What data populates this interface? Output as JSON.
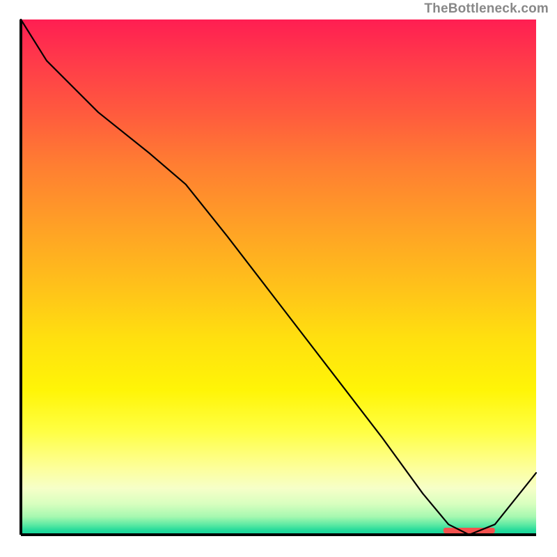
{
  "attribution": "TheBottleneck.com",
  "chart_data": {
    "type": "line",
    "title": "",
    "xlabel": "",
    "ylabel": "",
    "xlim": [
      0,
      100
    ],
    "ylim": [
      0,
      100
    ],
    "x": [
      0,
      5,
      15,
      25,
      32,
      40,
      50,
      60,
      70,
      78,
      83,
      87,
      92,
      100
    ],
    "values": [
      100,
      92,
      82,
      74,
      68,
      58,
      45,
      32,
      19,
      8,
      2,
      0,
      2,
      12
    ],
    "optimum_range": [
      82,
      92
    ],
    "gradient_palette": {
      "top": "#ff1e52",
      "mid": "#ffe00f",
      "bottom": "#10d49a"
    }
  }
}
